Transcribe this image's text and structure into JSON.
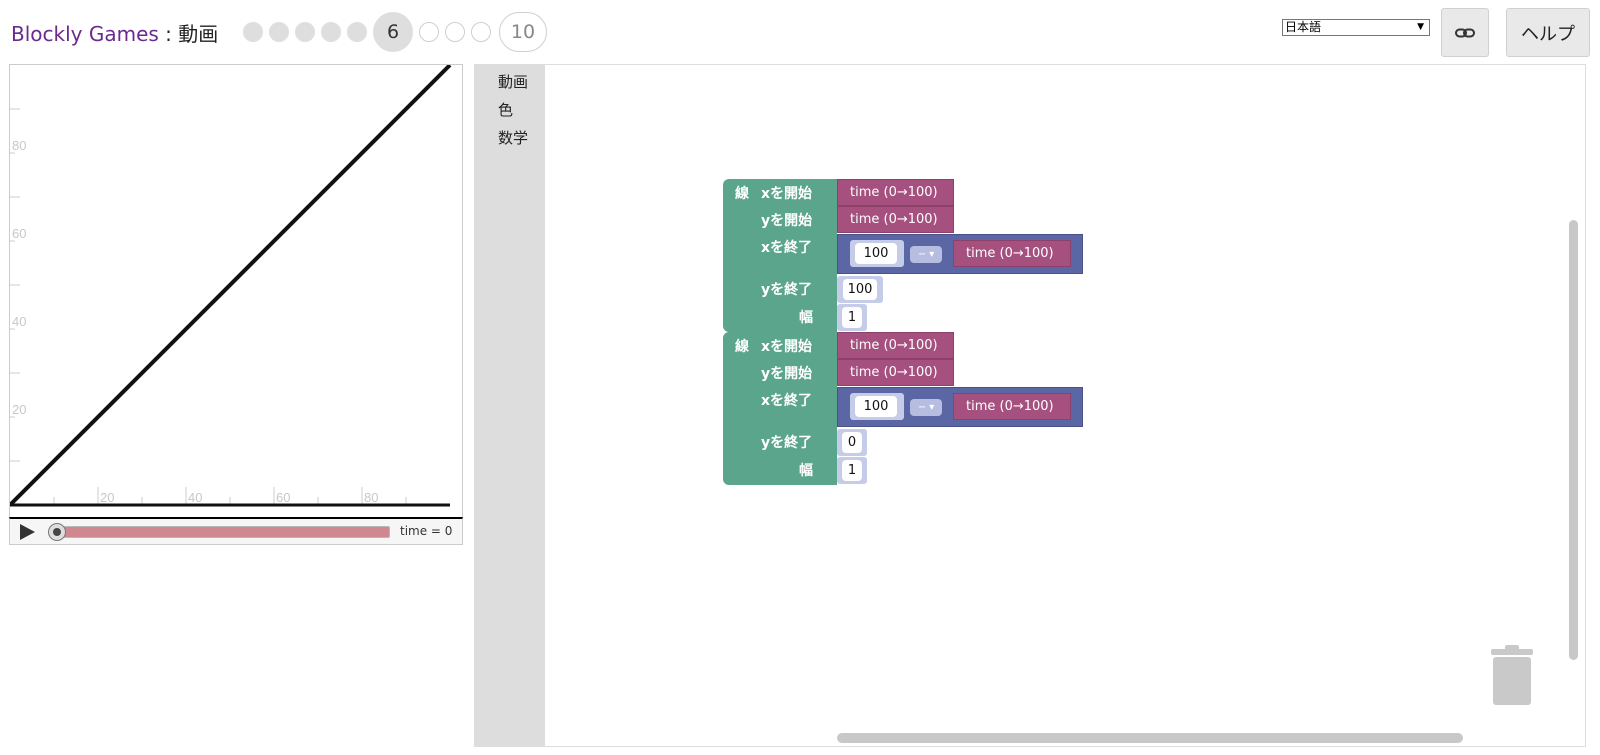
{
  "header": {
    "brand": "Blockly Games",
    "separator": " : ",
    "page_name": "動画",
    "current_level": "6",
    "last_level": "10",
    "language": "日本語",
    "help_label": "ヘルプ"
  },
  "viz": {
    "x_ticks": [
      "20",
      "40",
      "60",
      "80"
    ],
    "y_ticks": [
      "80",
      "60",
      "40",
      "20"
    ],
    "time_label": "time = 0",
    "time_value": 0
  },
  "toolbox": {
    "categories": [
      "動画",
      "色",
      "数学"
    ]
  },
  "blocks": {
    "line_label": "線",
    "x_start": "xを開始",
    "y_start": "yを開始",
    "x_end": "xを終了",
    "y_end": "yを終了",
    "width": "幅",
    "time": "time (0→100)",
    "op": "− ▾",
    "block1": {
      "x_minuend": "100",
      "y_end_value": "100",
      "width_value": "1"
    },
    "block2": {
      "x_minuend": "100",
      "y_end_value": "0",
      "width_value": "1"
    }
  },
  "colors": {
    "brand": "#6a2a8e",
    "animation_block": "#5ba58c",
    "time_block": "#a5507f",
    "math_block": "#5b67a5"
  }
}
